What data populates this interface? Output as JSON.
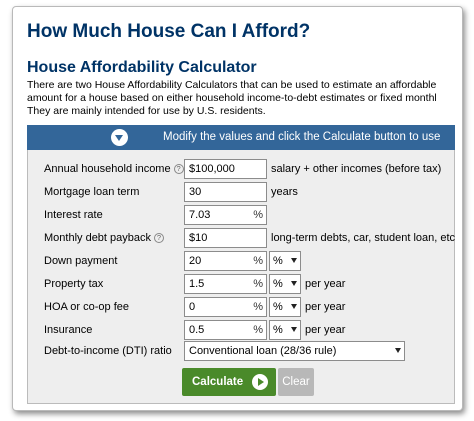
{
  "header": {
    "title": "How Much House Can I Afford?",
    "calc_title": "House Affordability Calculator",
    "intro_lines": [
      "There are two House Affordability Calculators that can be used to estimate an affordable",
      "amount for a house based on either household income-to-debt estimates or fixed monthl",
      "They are mainly intended for use by U.S. residents."
    ]
  },
  "banner": {
    "text": "Modify the values and click the Calculate button to use",
    "icon": "chevron-down-circle-icon"
  },
  "form": {
    "income": {
      "label": "Annual household income",
      "value": "$100,000",
      "suffix": "salary + other incomes (before tax)"
    },
    "loan_term": {
      "label": "Mortgage loan term",
      "value": "30",
      "suffix": "years"
    },
    "interest": {
      "label": "Interest rate",
      "value": "7.03",
      "unit": "%"
    },
    "debt": {
      "label": "Monthly debt payback",
      "value": "$10",
      "suffix": "long-term debts, car, student loan, etc"
    },
    "down_payment": {
      "label": "Down payment",
      "value": "20",
      "unit": "%",
      "select": "%"
    },
    "property_tax": {
      "label": "Property tax",
      "value": "1.5",
      "unit": "%",
      "select": "%",
      "suffix": "per year"
    },
    "hoa": {
      "label": "HOA or co-op fee",
      "value": "0",
      "unit": "%",
      "select": "%",
      "suffix": "per year"
    },
    "insurance": {
      "label": "Insurance",
      "value": "0.5",
      "unit": "%",
      "select": "%",
      "suffix": "per year"
    },
    "dti": {
      "label": "Debt-to-income (DTI) ratio",
      "value": "Conventional loan (28/36 rule)"
    },
    "help_glyph": "?"
  },
  "buttons": {
    "calculate": "Calculate",
    "clear": "Clear"
  },
  "colors": {
    "title": "#003366",
    "banner": "#336699",
    "calculate": "#4a8a2a",
    "clear": "#b8b8b8"
  }
}
